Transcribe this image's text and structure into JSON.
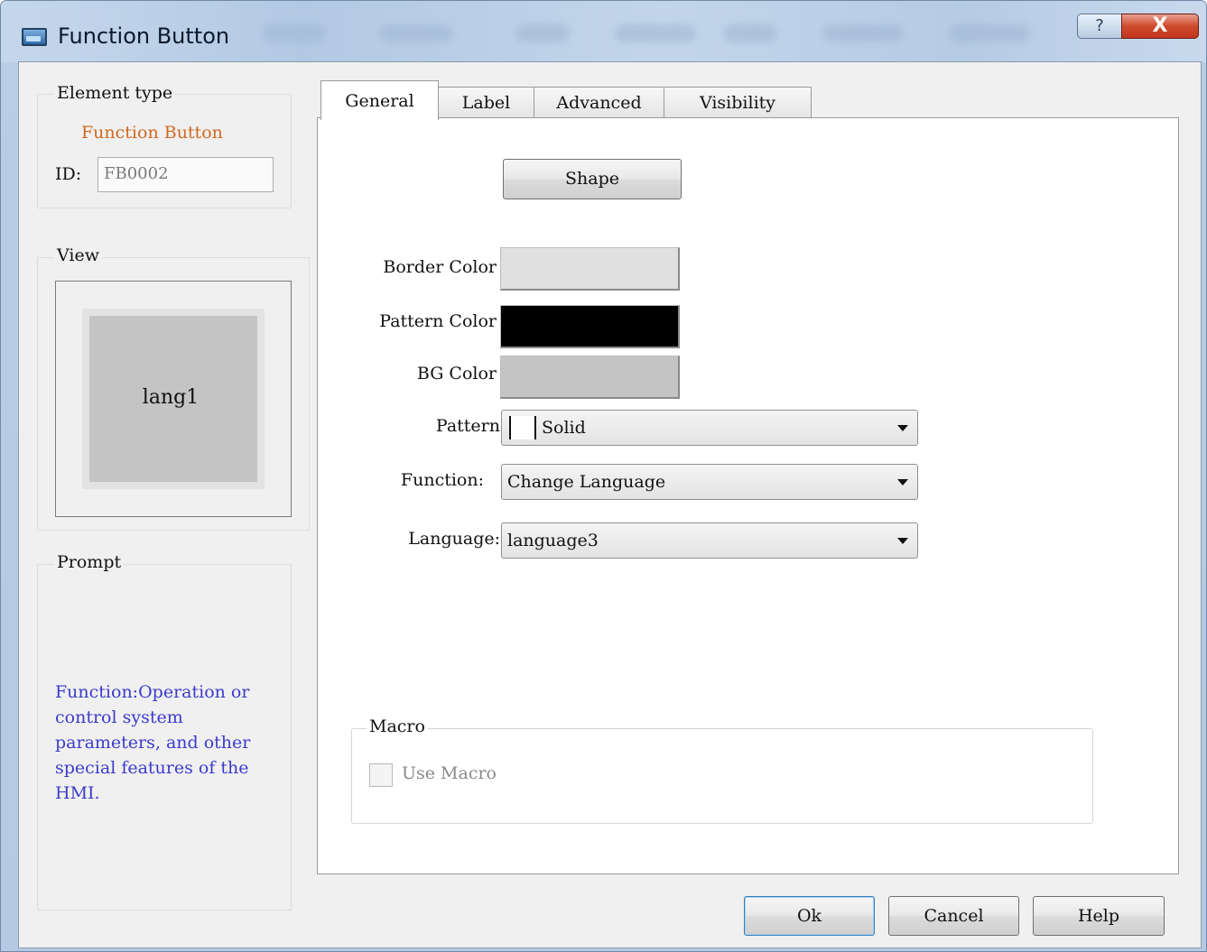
{
  "window": {
    "title": "Function Button",
    "help_label": "?",
    "close_label": "X"
  },
  "element_type": {
    "group_title": "Element type",
    "type_value": "Function Button",
    "id_label": "ID:",
    "id_value": "FB0002"
  },
  "view": {
    "group_title": "View",
    "preview_text": "lang1"
  },
  "prompt": {
    "group_title": "Prompt",
    "text": "Function:Operation or control system parameters, and other special features of the HMI."
  },
  "tabs": [
    {
      "label": "General",
      "active": true
    },
    {
      "label": "Label",
      "active": false
    },
    {
      "label": "Advanced",
      "active": false
    },
    {
      "label": "Visibility",
      "active": false
    }
  ],
  "general": {
    "shape_button": "Shape",
    "border_color_label": "Border Color",
    "pattern_color_label": "Pattern Color",
    "bg_color_label": "BG Color",
    "pattern_label": "Pattern",
    "pattern_value": "Solid",
    "function_label": "Function:",
    "function_value": "Change Language",
    "language_label": "Language:",
    "language_value": "language3",
    "macro_group_title": "Macro",
    "use_macro_label": "Use Macro",
    "use_macro_checked": false
  },
  "colors": {
    "border_color": "#e0e0e0",
    "pattern_color": "#000000",
    "bg_color": "#c4c4c4",
    "type_value_color": "#d2691e",
    "prompt_text_color": "#3b3bcc"
  },
  "footer": {
    "ok_label": "Ok",
    "cancel_label": "Cancel",
    "help_label": "Help"
  }
}
